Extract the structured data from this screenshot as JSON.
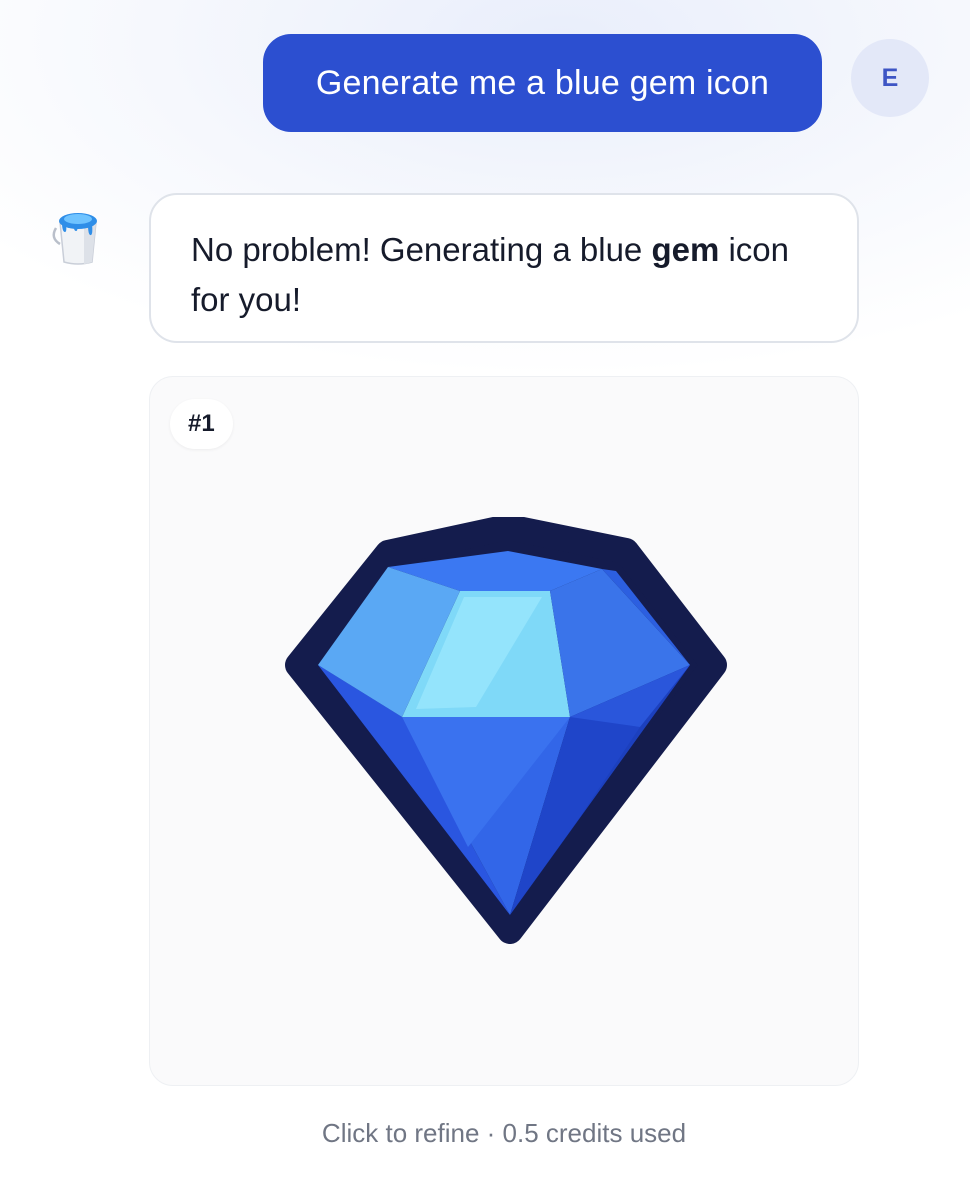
{
  "chat": {
    "user_message": "Generate me a blue gem icon",
    "user_avatar_initial": "E",
    "bot_message_before": "No problem! Generating a blue ",
    "bot_message_bold": "gem",
    "bot_message_after": " icon for you!"
  },
  "result": {
    "badge": "#1",
    "image_icon": "blue-gem-icon"
  },
  "footer": {
    "note": "Click to refine · 0.5 credits used"
  },
  "colors": {
    "user_bubble": "#2c4fd0",
    "avatar_bg": "#e3e8f8",
    "gem_outline": "#141c4d",
    "gem_primary": "#2a56e0"
  }
}
